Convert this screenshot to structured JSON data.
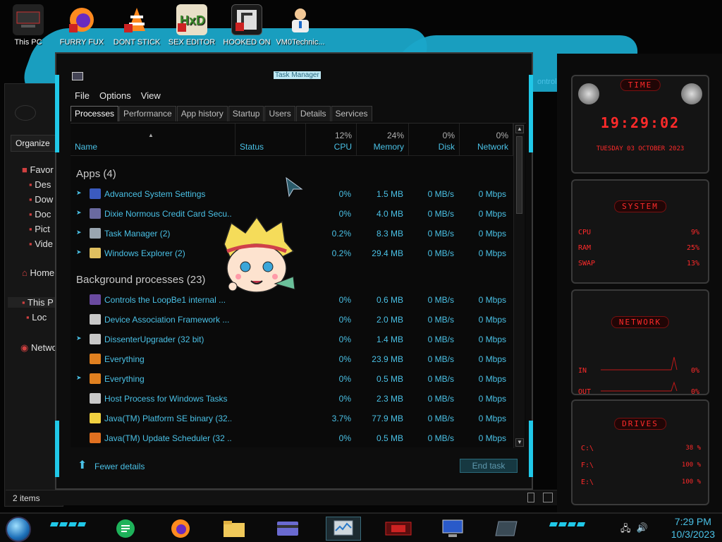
{
  "desktop": {
    "icons": [
      {
        "label": "This PC",
        "icon": "pc-icon"
      },
      {
        "label": "FURRY FUX",
        "icon": "firefox-icon"
      },
      {
        "label": "DONT STICK",
        "icon": "vlc-cone-icon"
      },
      {
        "label": "SEX EDITOR",
        "icon": "hxd-icon"
      },
      {
        "label": "HOOKED ON",
        "icon": "game-icon"
      },
      {
        "label": "VM0Technic...",
        "icon": "doctor-icon"
      }
    ]
  },
  "explorer": {
    "organize": "Organize",
    "nav": [
      "Favor",
      "Des",
      "Dow",
      "Doc",
      "Pict",
      "Vide",
      "Home",
      "This P",
      "Loc",
      "Netwo"
    ],
    "status": "2 items"
  },
  "task_manager": {
    "title": "Task Manager",
    "menu": [
      "File",
      "Options",
      "View"
    ],
    "tabs": [
      "Processes",
      "Performance",
      "App history",
      "Startup",
      "Users",
      "Details",
      "Services"
    ],
    "active_tab": "Processes",
    "columns": {
      "name": "Name",
      "status": "Status",
      "cpu": {
        "pct": "12%",
        "label": "CPU"
      },
      "memory": {
        "pct": "24%",
        "label": "Memory"
      },
      "disk": {
        "pct": "0%",
        "label": "Disk"
      },
      "network": {
        "pct": "0%",
        "label": "Network"
      }
    },
    "groups": {
      "apps": "Apps (4)",
      "background": "Background processes (23)"
    },
    "apps": [
      {
        "name": "Advanced System Settings",
        "cpu": "0%",
        "mem": "1.5 MB",
        "disk": "0 MB/s",
        "net": "0 Mbps",
        "expand": true,
        "icon_color": "#3b5bbf"
      },
      {
        "name": "Dixie Normous Credit Card Secu...",
        "cpu": "0%",
        "mem": "4.0 MB",
        "disk": "0 MB/s",
        "net": "0 Mbps",
        "expand": true,
        "icon_color": "#6a6aa0"
      },
      {
        "name": "Task Manager (2)",
        "cpu": "0.2%",
        "mem": "8.3 MB",
        "disk": "0 MB/s",
        "net": "0 Mbps",
        "expand": true,
        "icon_color": "#9aa6b0"
      },
      {
        "name": "Windows Explorer (2)",
        "cpu": "0.2%",
        "mem": "29.4 MB",
        "disk": "0 MB/s",
        "net": "0 Mbps",
        "expand": true,
        "icon_color": "#e0c060"
      }
    ],
    "background": [
      {
        "name": "Controls the LoopBe1 internal ...",
        "cpu": "0%",
        "mem": "0.6 MB",
        "disk": "0 MB/s",
        "net": "0 Mbps",
        "expand": false,
        "icon_color": "#6a4aa0"
      },
      {
        "name": "Device Association Framework ...",
        "cpu": "0%",
        "mem": "2.0 MB",
        "disk": "0 MB/s",
        "net": "0 Mbps",
        "expand": false,
        "icon_color": "#c8c8c8"
      },
      {
        "name": "DissenterUpgrader (32 bit)",
        "cpu": "0%",
        "mem": "1.4 MB",
        "disk": "0 MB/s",
        "net": "0 Mbps",
        "expand": true,
        "icon_color": "#c8c8c8"
      },
      {
        "name": "Everything",
        "cpu": "0%",
        "mem": "23.9 MB",
        "disk": "0 MB/s",
        "net": "0 Mbps",
        "expand": false,
        "icon_color": "#e08020"
      },
      {
        "name": "Everything",
        "cpu": "0%",
        "mem": "0.5 MB",
        "disk": "0 MB/s",
        "net": "0 Mbps",
        "expand": true,
        "icon_color": "#e08020"
      },
      {
        "name": "Host Process for Windows Tasks",
        "cpu": "0%",
        "mem": "2.3 MB",
        "disk": "0 MB/s",
        "net": "0 Mbps",
        "expand": false,
        "icon_color": "#c8c8c8"
      },
      {
        "name": "Java(TM) Platform SE binary (32...",
        "cpu": "3.7%",
        "mem": "77.9 MB",
        "disk": "0 MB/s",
        "net": "0 Mbps",
        "expand": false,
        "icon_color": "#f0d040"
      },
      {
        "name": "Java(TM) Update Scheduler (32 ...",
        "cpu": "0%",
        "mem": "0.5 MB",
        "disk": "0 MB/s",
        "net": "0 Mbps",
        "expand": false,
        "icon_color": "#e07020"
      }
    ],
    "fewer_details": "Fewer details",
    "end_task": "End task"
  },
  "gadgets": {
    "time_title": "TIME",
    "time_value": "19:29:02",
    "date_value": "TUESDAY 03 OCTOBER 2023",
    "system_title": "SYSTEM",
    "system_rows": [
      {
        "label": "CPU",
        "value": "9%"
      },
      {
        "label": "RAM",
        "value": "25%"
      },
      {
        "label": "SWAP",
        "value": "13%"
      }
    ],
    "network_title": "NETWORK",
    "network_rows": [
      {
        "label": "IN",
        "value": "0%"
      },
      {
        "label": "OUT",
        "value": "0%"
      }
    ],
    "drives_title": "DRIVES",
    "drives_rows": [
      {
        "label": "C:\\",
        "value": "38 %"
      },
      {
        "label": "F:\\",
        "value": "100 %"
      },
      {
        "label": "E:\\",
        "value": "100 %"
      }
    ],
    "control_label": "ontrol"
  },
  "taskbar": {
    "time": "7:29 PM",
    "date": "10/3/2023"
  }
}
